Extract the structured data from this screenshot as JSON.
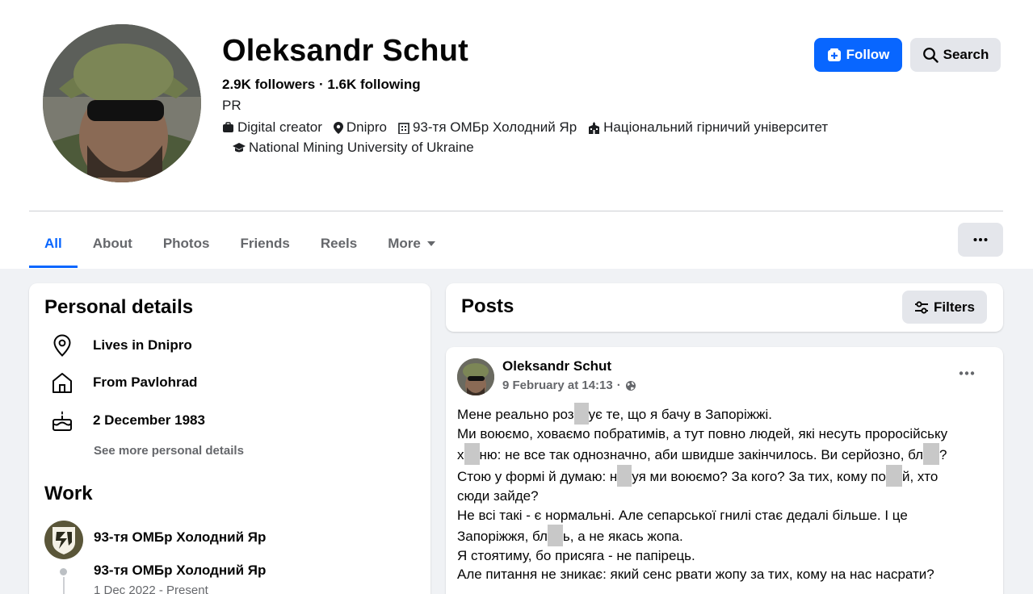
{
  "profile": {
    "name": "Oleksandr Schut",
    "followers_line": "2.9K followers · 1.6K following",
    "bio": "PR",
    "meta": [
      {
        "icon": "briefcase-icon",
        "text": "Digital creator"
      },
      {
        "icon": "location-pin-icon",
        "text": "Dnipro"
      },
      {
        "icon": "building-icon",
        "text": "93-тя ОМБр Холодний Яр"
      },
      {
        "icon": "school-icon",
        "text": "Національний гірничий університет"
      },
      {
        "icon": "graduation-cap-icon",
        "text": "National Mining University of Ukraine"
      }
    ],
    "follow_label": "Follow",
    "search_label": "Search"
  },
  "tabs": [
    {
      "label": "All",
      "active": true
    },
    {
      "label": "About"
    },
    {
      "label": "Photos"
    },
    {
      "label": "Friends"
    },
    {
      "label": "Reels"
    },
    {
      "label": "More"
    }
  ],
  "personal": {
    "title": "Personal details",
    "items": [
      {
        "icon": "location-pin-icon",
        "text": "Lives in Dnipro"
      },
      {
        "icon": "home-icon",
        "text": "From Pavlohrad"
      },
      {
        "icon": "birthday-cake-icon",
        "text": "2 December 1983"
      }
    ],
    "see_more": "See more personal details"
  },
  "work": {
    "title": "Work",
    "employer": "93-тя ОМБр Холодний Яр",
    "position": "93-тя ОМБр Холодний Яр",
    "dates": "1 Dec 2022 - Present"
  },
  "posts": {
    "title": "Posts",
    "filters_label": "Filters"
  },
  "post": {
    "author": "Oleksandr Schut",
    "date": "9 February at 14:13",
    "separator": "·",
    "visibility_icon": "globe-icon",
    "lines": [
      [
        "Мене реально роз",
        "",
        "ує те, що я бачу в Запоріжжі."
      ],
      [
        "Ми воюємо, ховаємо побратимів, а тут повно людей, які несуть проросійську"
      ],
      [
        "х",
        "",
        "ню: не все так однозначно, аби швидше закінчилось. Ви серйозно, бл",
        "",
        "?"
      ],
      [
        "Стою у формі й думаю: н",
        "",
        "уя ми воюємо? За кого? За тих, кому по",
        "",
        "й, хто"
      ],
      [
        "сюди зайде?"
      ],
      [
        "Не всі такі - є нормальні. Але сепарської гнилі стає дедалі більше. І це"
      ],
      [
        "Запоріжжя, бл",
        "",
        "ь, а не якась жопа."
      ],
      [
        "Я стоятиму, бо присяга - не папірець."
      ],
      [
        "Але питання не зникає: який сенс рвати жопу за тих, кому на нас насрати?"
      ]
    ]
  },
  "colors": {
    "accent": "#0866ff",
    "page_bg": "#f0f2f5",
    "secondary_button": "#e4e6eb",
    "muted_text": "#65676b"
  }
}
